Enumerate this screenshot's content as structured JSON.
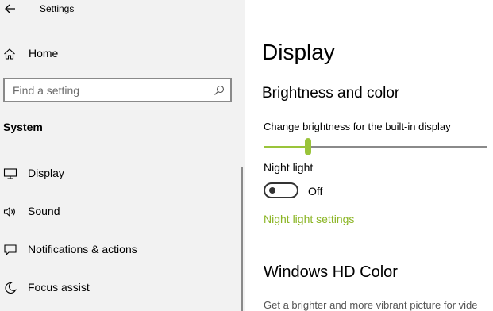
{
  "window": {
    "title": "Settings"
  },
  "sidebar": {
    "home_label": "Home",
    "search_placeholder": "Find a setting",
    "section_header": "System",
    "items": [
      {
        "label": "Display",
        "icon": "monitor-icon"
      },
      {
        "label": "Sound",
        "icon": "speaker-icon"
      },
      {
        "label": "Notifications & actions",
        "icon": "notification-icon"
      },
      {
        "label": "Focus assist",
        "icon": "moon-icon"
      }
    ]
  },
  "content": {
    "page_title": "Display",
    "section_title": "Brightness and color",
    "brightness_label": "Change brightness for the built-in display",
    "brightness_value": 20,
    "night_light_label": "Night light",
    "night_light_state": "Off",
    "night_light_link": "Night light settings",
    "hdr_title": "Windows HD Color",
    "hdr_description": "Get a brighter and more vibrant picture for vide"
  },
  "colors": {
    "accent": "#9ac43a",
    "link": "#8bb524",
    "sidebar_bg": "#f2f2f2"
  }
}
